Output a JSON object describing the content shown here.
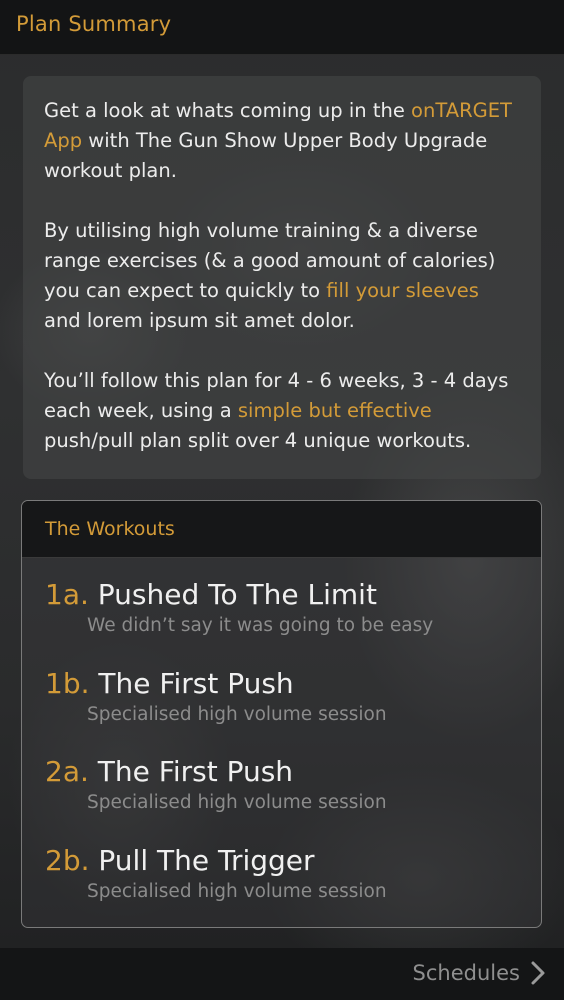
{
  "header": {
    "title": "Plan Summary"
  },
  "intro": {
    "p1": {
      "a": "Get a look at whats coming up in the ",
      "highlight": "onTARGET App",
      "b": " with The Gun Show Upper Body Upgrade workout plan."
    },
    "p2": {
      "a": "By utilising high volume training & a diverse range exercises (& a good amount of calories) you can expect to quickly to ",
      "highlight": "fill your sleeves",
      "b": " and lorem ipsum sit amet dolor."
    },
    "p3": {
      "a": "You’ll follow this plan for 4 - 6 weeks, 3 - 4 days each week, using a ",
      "highlight": "simple but effective",
      "b": " push/pull plan split over 4 unique workouts."
    }
  },
  "workouts": {
    "heading": "The Workouts",
    "items": [
      {
        "code": "1a.",
        "name": "Pushed To The Limit",
        "subtitle": "We didn’t say it was going to be easy"
      },
      {
        "code": "1b.",
        "name": "The First Push",
        "subtitle": "Specialised high volume session"
      },
      {
        "code": "2a.",
        "name": "The First Push",
        "subtitle": "Specialised high volume session"
      },
      {
        "code": "2b.",
        "name": "Pull The Trigger",
        "subtitle": "Specialised high volume session"
      }
    ]
  },
  "footer": {
    "schedules_label": "Schedules",
    "icon": "chevron-right-icon"
  },
  "colors": {
    "accent": "#d39b38",
    "text": "#ececec",
    "muted": "#8c8c8c"
  }
}
